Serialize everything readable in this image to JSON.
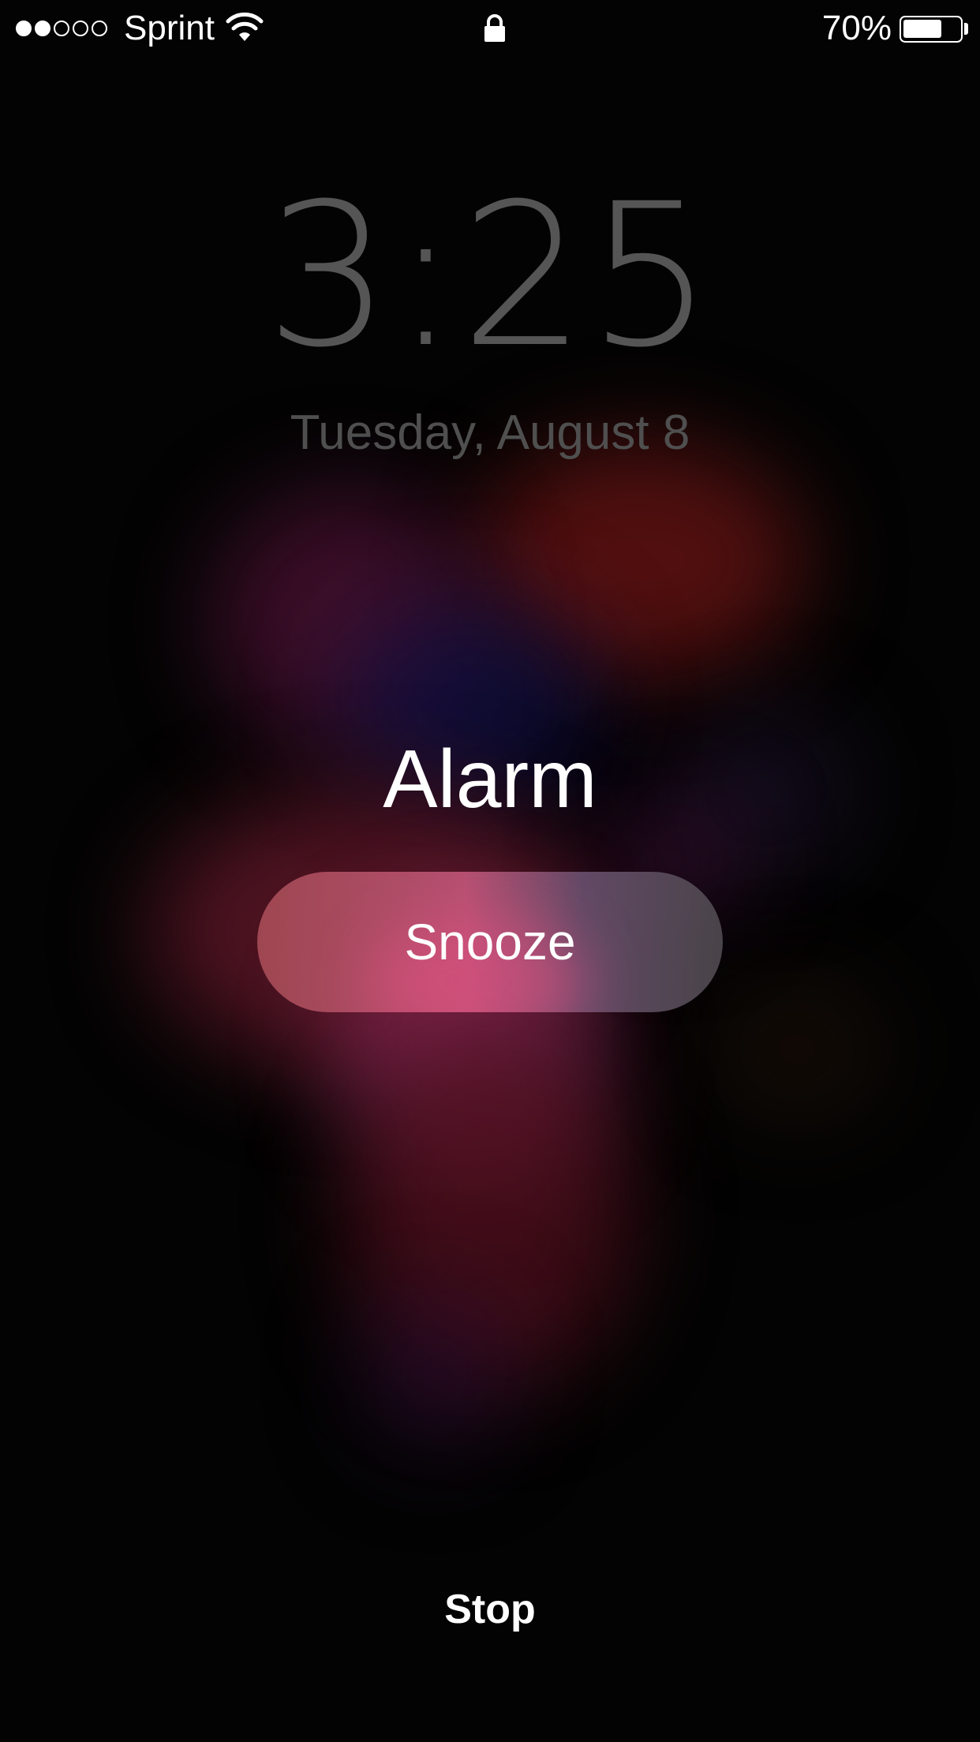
{
  "status_bar": {
    "signal_strength": {
      "filled": 2,
      "total": 5
    },
    "carrier": "Sprint",
    "wifi_icon": "wifi-icon",
    "lock_icon": "lock-icon",
    "battery_percent_text": "70%",
    "battery_level": 0.7
  },
  "lock_screen": {
    "time": "3:25",
    "date": "Tuesday, August 8"
  },
  "alarm": {
    "title": "Alarm",
    "snooze_label": "Snooze",
    "stop_label": "Stop"
  },
  "colors": {
    "background": "#030303",
    "time_text": "#555555",
    "date_text": "#4f4f4f",
    "primary_text": "#ffffff"
  }
}
